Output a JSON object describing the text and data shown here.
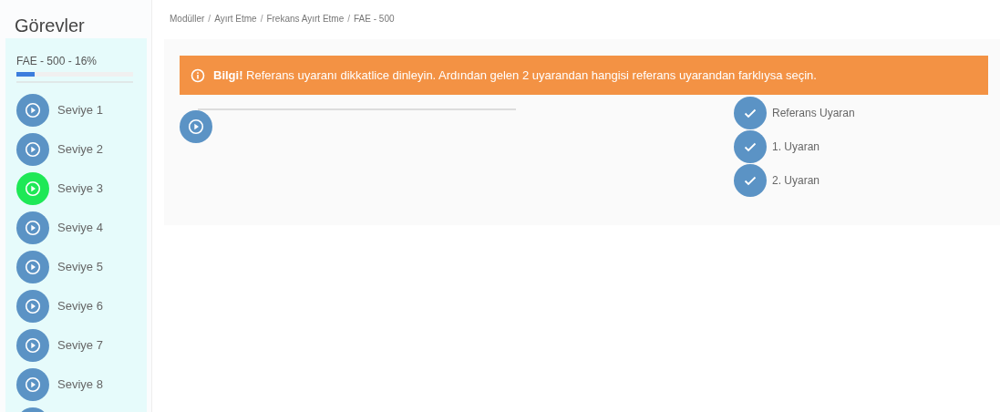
{
  "sidebar": {
    "title": "Görevler",
    "progress": {
      "label": "FAE - 500 - 16%",
      "level": 0.16
    },
    "levels": [
      {
        "label": "Seviye 1",
        "active": false
      },
      {
        "label": "Seviye 2",
        "active": false
      },
      {
        "label": "Seviye 3",
        "active": true
      },
      {
        "label": "Seviye 4",
        "active": false
      },
      {
        "label": "Seviye 5",
        "active": false
      },
      {
        "label": "Seviye 6",
        "active": false
      },
      {
        "label": "Seviye 7",
        "active": false
      },
      {
        "label": "Seviye 8",
        "active": false
      },
      {
        "active": false
      }
    ]
  },
  "breadcrumb": {
    "separator": "/",
    "items": [
      "Modüller",
      "Ayırt Etme",
      "Frekans Ayırt Etme",
      "FAE - 500"
    ]
  },
  "alert": {
    "text": "**Bilgi!** Referans uyaranı dikkatlice dinleyin. Ardından gelen 2 uyarandan hangisi referans uyarandan farklıysa seçin."
  },
  "stimuli": [
    {
      "label": "Referans Uyaran",
      "checked": true
    },
    {
      "label": "1. Uyaran",
      "checked": true
    },
    {
      "label": "2. Uyaran",
      "checked": true
    }
  ]
}
